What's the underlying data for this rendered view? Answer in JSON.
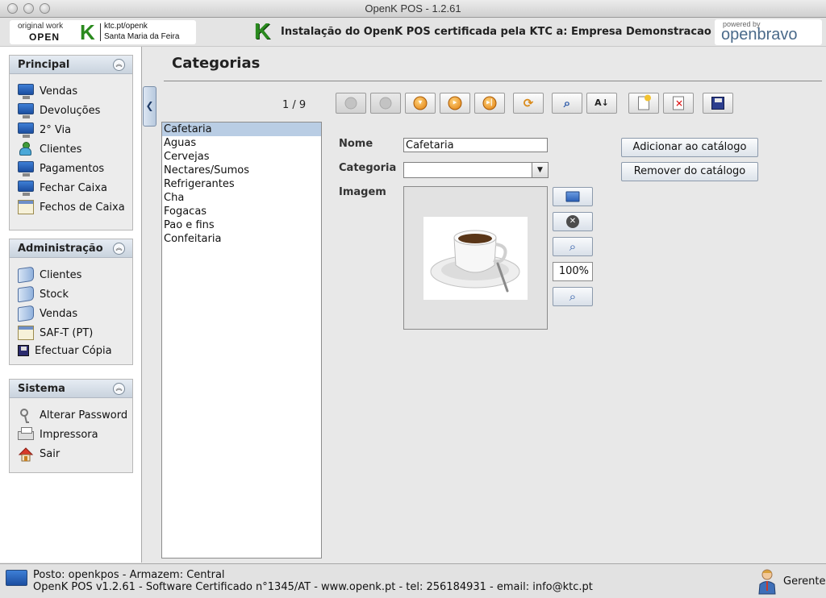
{
  "window": {
    "title": "OpenK POS - 1.2.61"
  },
  "header": {
    "brand_small": "original work",
    "brand_name": "OPEN",
    "brand_k": "K",
    "brand_url": "ktc.pt/openk",
    "brand_city": "Santa Maria da Feira",
    "cert_k": "K",
    "cert_text": "Instalação do OpenK POS certificada pela KTC a: Empresa Demonstracao Lda",
    "powered_by": "powered by",
    "partner": "openbravo"
  },
  "sidebar": {
    "principal": {
      "title": "Principal",
      "items": [
        {
          "label": "Vendas",
          "icon": "monitor-icon"
        },
        {
          "label": "Devoluções",
          "icon": "monitor-icon"
        },
        {
          "label": "2° Via",
          "icon": "monitor-icon"
        },
        {
          "label": "Clientes",
          "icon": "people-icon"
        },
        {
          "label": "Pagamentos",
          "icon": "monitor-icon"
        },
        {
          "label": "Fechar Caixa",
          "icon": "monitor-icon"
        },
        {
          "label": "Fechos de Caixa",
          "icon": "calendar-icon"
        }
      ]
    },
    "administracao": {
      "title": "Administração",
      "items": [
        {
          "label": "Clientes",
          "icon": "book-icon"
        },
        {
          "label": "Stock",
          "icon": "book-icon"
        },
        {
          "label": "Vendas",
          "icon": "book-icon"
        },
        {
          "label": "SAF-T (PT)",
          "icon": "calendar-icon"
        },
        {
          "label": "Efectuar Cópia",
          "icon": "disk-icon"
        }
      ]
    },
    "sistema": {
      "title": "Sistema",
      "items": [
        {
          "label": "Alterar Password",
          "icon": "key-icon"
        },
        {
          "label": "Impressora",
          "icon": "printer-icon"
        },
        {
          "label": "Sair",
          "icon": "house-icon"
        }
      ]
    },
    "collapse_glyph": "❮"
  },
  "main": {
    "title": "Categorias",
    "counter": "1 / 9",
    "toolbar": [
      {
        "name": "first-record-button",
        "icon": "first-icon",
        "enabled": false
      },
      {
        "name": "previous-record-button",
        "icon": "previous-icon",
        "enabled": false
      },
      {
        "name": "next-record-button",
        "icon": "next-icon",
        "enabled": true
      },
      {
        "name": "play-record-button",
        "icon": "play-icon",
        "enabled": true
      },
      {
        "name": "last-record-button",
        "icon": "last-icon",
        "enabled": true
      },
      {
        "name": "reload-button",
        "icon": "reload-icon",
        "enabled": true
      },
      {
        "name": "search-button",
        "icon": "search-icon",
        "enabled": true
      },
      {
        "name": "sort-button",
        "icon": "sort-az-icon",
        "enabled": true
      },
      {
        "name": "new-record-button",
        "icon": "new-document-icon",
        "enabled": true
      },
      {
        "name": "delete-record-button",
        "icon": "delete-document-icon",
        "enabled": true
      },
      {
        "name": "save-button",
        "icon": "save-icon",
        "enabled": true
      }
    ],
    "categories": [
      "Cafetaria",
      "Aguas",
      "Cervejas",
      "Nectares/Sumos",
      "Refrigerantes",
      "Cha",
      "Fogacas",
      "Pao e fins",
      "Confeitaria"
    ],
    "selected_category": "Cafetaria",
    "form": {
      "nome_label": "Nome",
      "nome_value": "Cafetaria",
      "categoria_label": "Categoria",
      "categoria_value": "",
      "imagem_label": "Imagem",
      "zoom": "100%"
    },
    "catalog": {
      "add_label": "Adicionar ao catálogo",
      "remove_label": "Remover do catálogo"
    }
  },
  "footer": {
    "line1": "Posto: openkpos - Armazem: Central",
    "line2": "OpenK POS v1.2.61 - Software Certificado n°1345/AT - www.openk.pt - tel: 256184931 - email: info@ktc.pt",
    "user": "Gerente"
  },
  "colors": {
    "selection": "#b9cde4",
    "brand_green": "#2a8a1e",
    "panel_header": "#c9d3de"
  }
}
